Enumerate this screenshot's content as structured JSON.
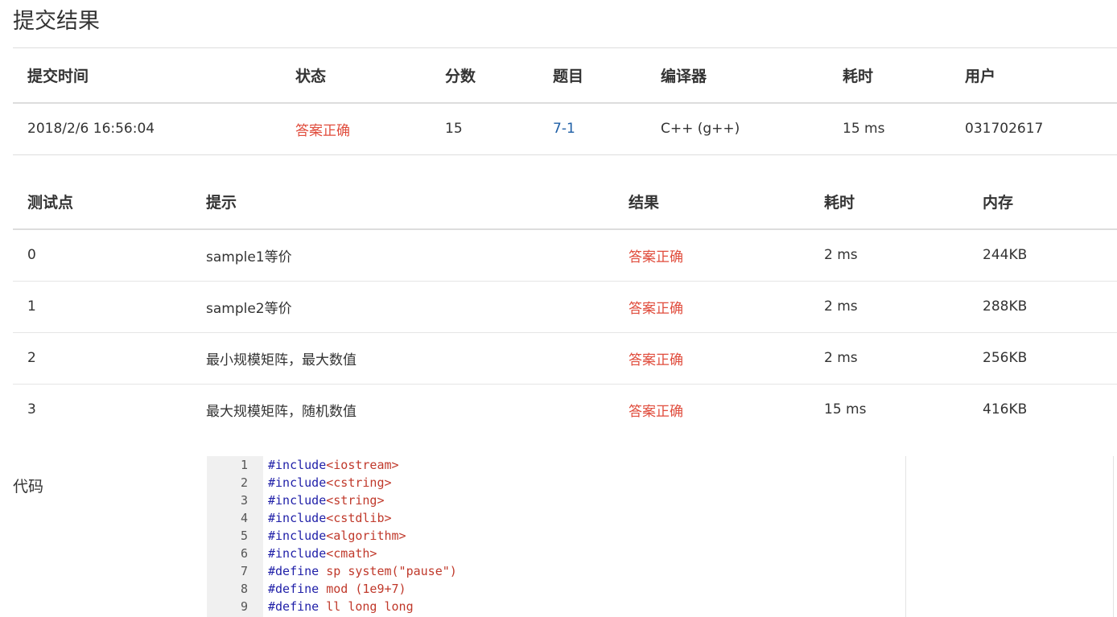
{
  "page": {
    "title": "提交结果"
  },
  "summary": {
    "headers": [
      "提交时间",
      "状态",
      "分数",
      "题目",
      "编译器",
      "耗时",
      "用户"
    ],
    "row": {
      "time": "2018/2/6 16:56:04",
      "status": "答案正确",
      "score": "15",
      "problem": "7-1",
      "compiler": "C++ (g++)",
      "duration": "15 ms",
      "user": "031702617"
    }
  },
  "cases": {
    "headers": [
      "测试点",
      "提示",
      "结果",
      "耗时",
      "内存"
    ],
    "rows": [
      {
        "id": "0",
        "hint": "sample1等价",
        "result": "答案正确",
        "time": "2 ms",
        "memory": "244KB"
      },
      {
        "id": "1",
        "hint": "sample2等价",
        "result": "答案正确",
        "time": "2 ms",
        "memory": "288KB"
      },
      {
        "id": "2",
        "hint": "最小规模矩阵，最大数值",
        "result": "答案正确",
        "time": "2 ms",
        "memory": "256KB"
      },
      {
        "id": "3",
        "hint": "最大规模矩阵，随机数值",
        "result": "答案正确",
        "time": "15 ms",
        "memory": "416KB"
      }
    ]
  },
  "code": {
    "label": "代码",
    "lines": [
      {
        "n": "1",
        "kw": "#include",
        "rest": "<iostream>"
      },
      {
        "n": "2",
        "kw": "#include",
        "rest": "<cstring>"
      },
      {
        "n": "3",
        "kw": "#include",
        "rest": "<string>"
      },
      {
        "n": "4",
        "kw": "#include",
        "rest": "<cstdlib>"
      },
      {
        "n": "5",
        "kw": "#include",
        "rest": "<algorithm>"
      },
      {
        "n": "6",
        "kw": "#include",
        "rest": "<cmath>"
      },
      {
        "n": "7",
        "kw": "#define",
        "rest": " sp system(\"pause\")"
      },
      {
        "n": "8",
        "kw": "#define",
        "rest": " mod (1e9+7)"
      },
      {
        "n": "9",
        "kw": "#define",
        "rest": " ll long long"
      }
    ]
  },
  "colors": {
    "accepted": "#e04c3c",
    "link": "#1f5fa6",
    "keyword": "#1f1fa8",
    "gutter_bg": "#f0f0f0"
  }
}
